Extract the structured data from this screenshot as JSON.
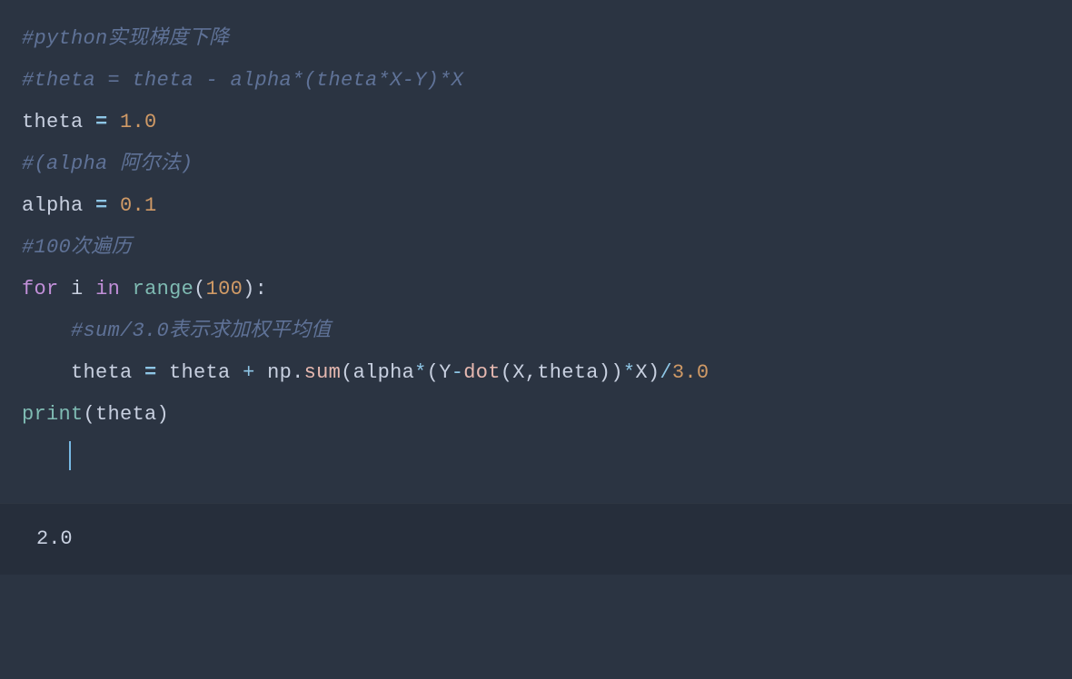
{
  "code": {
    "line1_comment": "#python实现梯度下降",
    "line2_comment": "#theta = theta - alpha*(theta*X-Y)*X",
    "line3": {
      "ident": "theta",
      "eq": " = ",
      "num": "1.0"
    },
    "line4_comment": "#(alpha 阿尔法)",
    "line5": {
      "ident": "alpha",
      "eq": " = ",
      "num": "0.1"
    },
    "line6_comment": "#100次遍历",
    "line7": {
      "for": "for",
      "sp1": " ",
      "i": "i",
      "sp2": " ",
      "in": "in",
      "sp3": " ",
      "range": "range",
      "lp": "(",
      "n": "100",
      "rp": ")",
      "colon": ":"
    },
    "line8": {
      "indent": "    ",
      "comment": "#sum/3.0表示求加权平均值"
    },
    "line9": {
      "indent": "    ",
      "theta1": "theta",
      "eq": " = ",
      "theta2": "theta",
      "plus": " + ",
      "np": "np",
      "dot1": ".",
      "sum": "sum",
      "lp1": "(",
      "alpha": "alpha",
      "mul1": "*",
      "lp2": "(",
      "Y": "Y",
      "minus": "-",
      "dotfn": "dot",
      "lp3": "(",
      "X1": "X",
      "comma": ",",
      "theta3": "theta",
      "rp3": ")",
      "rp2": ")",
      "mul2": "*",
      "X2": "X",
      "rp1": ")",
      "div": "/",
      "three": "3.0"
    },
    "line10": {
      "print": "print",
      "lp": "(",
      "theta": "theta",
      "rp": ")"
    }
  },
  "output": {
    "value": "2.0"
  }
}
